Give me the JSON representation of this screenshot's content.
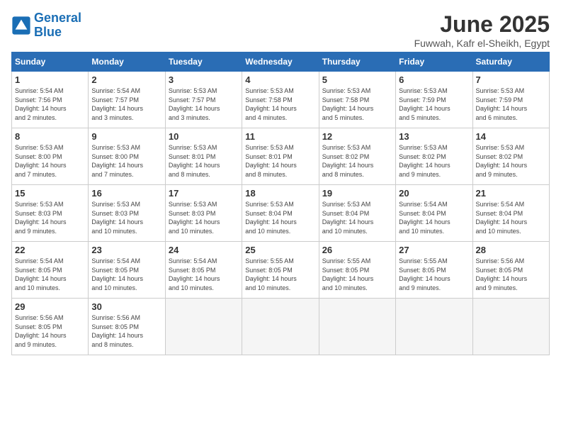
{
  "logo": {
    "line1": "General",
    "line2": "Blue"
  },
  "title": "June 2025",
  "subtitle": "Fuwwah, Kafr el-Sheikh, Egypt",
  "days_of_week": [
    "Sunday",
    "Monday",
    "Tuesday",
    "Wednesday",
    "Thursday",
    "Friday",
    "Saturday"
  ],
  "weeks": [
    [
      {
        "day": "1",
        "info": "Sunrise: 5:54 AM\nSunset: 7:56 PM\nDaylight: 14 hours\nand 2 minutes."
      },
      {
        "day": "2",
        "info": "Sunrise: 5:54 AM\nSunset: 7:57 PM\nDaylight: 14 hours\nand 3 minutes."
      },
      {
        "day": "3",
        "info": "Sunrise: 5:53 AM\nSunset: 7:57 PM\nDaylight: 14 hours\nand 3 minutes."
      },
      {
        "day": "4",
        "info": "Sunrise: 5:53 AM\nSunset: 7:58 PM\nDaylight: 14 hours\nand 4 minutes."
      },
      {
        "day": "5",
        "info": "Sunrise: 5:53 AM\nSunset: 7:58 PM\nDaylight: 14 hours\nand 5 minutes."
      },
      {
        "day": "6",
        "info": "Sunrise: 5:53 AM\nSunset: 7:59 PM\nDaylight: 14 hours\nand 5 minutes."
      },
      {
        "day": "7",
        "info": "Sunrise: 5:53 AM\nSunset: 7:59 PM\nDaylight: 14 hours\nand 6 minutes."
      }
    ],
    [
      {
        "day": "8",
        "info": "Sunrise: 5:53 AM\nSunset: 8:00 PM\nDaylight: 14 hours\nand 7 minutes."
      },
      {
        "day": "9",
        "info": "Sunrise: 5:53 AM\nSunset: 8:00 PM\nDaylight: 14 hours\nand 7 minutes."
      },
      {
        "day": "10",
        "info": "Sunrise: 5:53 AM\nSunset: 8:01 PM\nDaylight: 14 hours\nand 8 minutes."
      },
      {
        "day": "11",
        "info": "Sunrise: 5:53 AM\nSunset: 8:01 PM\nDaylight: 14 hours\nand 8 minutes."
      },
      {
        "day": "12",
        "info": "Sunrise: 5:53 AM\nSunset: 8:02 PM\nDaylight: 14 hours\nand 8 minutes."
      },
      {
        "day": "13",
        "info": "Sunrise: 5:53 AM\nSunset: 8:02 PM\nDaylight: 14 hours\nand 9 minutes."
      },
      {
        "day": "14",
        "info": "Sunrise: 5:53 AM\nSunset: 8:02 PM\nDaylight: 14 hours\nand 9 minutes."
      }
    ],
    [
      {
        "day": "15",
        "info": "Sunrise: 5:53 AM\nSunset: 8:03 PM\nDaylight: 14 hours\nand 9 minutes."
      },
      {
        "day": "16",
        "info": "Sunrise: 5:53 AM\nSunset: 8:03 PM\nDaylight: 14 hours\nand 10 minutes."
      },
      {
        "day": "17",
        "info": "Sunrise: 5:53 AM\nSunset: 8:03 PM\nDaylight: 14 hours\nand 10 minutes."
      },
      {
        "day": "18",
        "info": "Sunrise: 5:53 AM\nSunset: 8:04 PM\nDaylight: 14 hours\nand 10 minutes."
      },
      {
        "day": "19",
        "info": "Sunrise: 5:53 AM\nSunset: 8:04 PM\nDaylight: 14 hours\nand 10 minutes."
      },
      {
        "day": "20",
        "info": "Sunrise: 5:54 AM\nSunset: 8:04 PM\nDaylight: 14 hours\nand 10 minutes."
      },
      {
        "day": "21",
        "info": "Sunrise: 5:54 AM\nSunset: 8:04 PM\nDaylight: 14 hours\nand 10 minutes."
      }
    ],
    [
      {
        "day": "22",
        "info": "Sunrise: 5:54 AM\nSunset: 8:05 PM\nDaylight: 14 hours\nand 10 minutes."
      },
      {
        "day": "23",
        "info": "Sunrise: 5:54 AM\nSunset: 8:05 PM\nDaylight: 14 hours\nand 10 minutes."
      },
      {
        "day": "24",
        "info": "Sunrise: 5:54 AM\nSunset: 8:05 PM\nDaylight: 14 hours\nand 10 minutes."
      },
      {
        "day": "25",
        "info": "Sunrise: 5:55 AM\nSunset: 8:05 PM\nDaylight: 14 hours\nand 10 minutes."
      },
      {
        "day": "26",
        "info": "Sunrise: 5:55 AM\nSunset: 8:05 PM\nDaylight: 14 hours\nand 10 minutes."
      },
      {
        "day": "27",
        "info": "Sunrise: 5:55 AM\nSunset: 8:05 PM\nDaylight: 14 hours\nand 9 minutes."
      },
      {
        "day": "28",
        "info": "Sunrise: 5:56 AM\nSunset: 8:05 PM\nDaylight: 14 hours\nand 9 minutes."
      }
    ],
    [
      {
        "day": "29",
        "info": "Sunrise: 5:56 AM\nSunset: 8:05 PM\nDaylight: 14 hours\nand 9 minutes."
      },
      {
        "day": "30",
        "info": "Sunrise: 5:56 AM\nSunset: 8:05 PM\nDaylight: 14 hours\nand 8 minutes."
      },
      {
        "day": "",
        "info": ""
      },
      {
        "day": "",
        "info": ""
      },
      {
        "day": "",
        "info": ""
      },
      {
        "day": "",
        "info": ""
      },
      {
        "day": "",
        "info": ""
      }
    ]
  ]
}
